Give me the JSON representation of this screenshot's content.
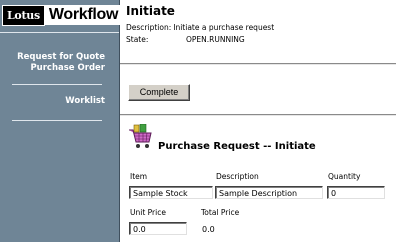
{
  "logo": {
    "lotus": "Lotus",
    "product": "Workflow"
  },
  "sidebar": {
    "items": [
      {
        "line1": "Request for Quote",
        "line2": "Purchase Order"
      },
      {
        "line1": "Worklist",
        "line2": ""
      }
    ]
  },
  "header": {
    "title": "Initiate",
    "description_label": "Description:",
    "description_value": "Initiate a purchase request",
    "state_label": "State:",
    "state_value": "OPEN.RUNNING"
  },
  "actions": {
    "complete_label": "Complete"
  },
  "form": {
    "icon": "shopping-cart-icon",
    "title": "Purchase Request -- Initiate",
    "item_label": "Item",
    "item_value": "Sample Stock",
    "description_label": "Description",
    "description_value": "Sample Description",
    "quantity_label": "Quantity",
    "quantity_value": "0",
    "unit_price_label": "Unit Price",
    "unit_price_value": "0.0",
    "total_price_label": "Total Price",
    "total_price_value": "0.0"
  },
  "colors": {
    "sidebar": "#6f8596",
    "sidebar_text": "#ffffff",
    "button_face": "#d4d0c8",
    "cart_accent": "#b03aa6"
  }
}
